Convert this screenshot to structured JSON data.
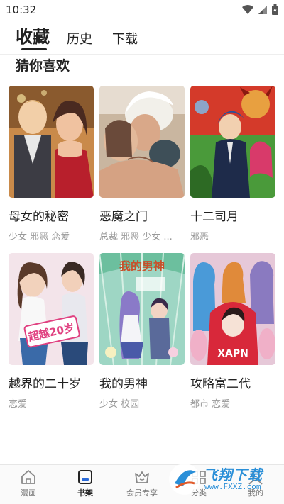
{
  "status": {
    "time": "10:32"
  },
  "tabs": {
    "active": "收藏",
    "history": "历史",
    "download": "下载"
  },
  "section": {
    "title": "猜你喜欢"
  },
  "comics": [
    {
      "title": "母女的秘密",
      "tags": "少女 邪恶 恋爱"
    },
    {
      "title": "恶魔之门",
      "tags": "总裁 邪恶 少女 ..."
    },
    {
      "title": "十二司月",
      "tags": "邪恶"
    },
    {
      "title": "越界的二十岁",
      "tags": "恋爱",
      "cover_text": "超越20岁"
    },
    {
      "title": "我的男神",
      "tags": "少女 校园",
      "cover_text": "我的男神"
    },
    {
      "title": "攻略富二代",
      "tags": "都市 恋爱",
      "cover_text": "XAPN"
    }
  ],
  "nav": [
    {
      "label": "漫画",
      "icon": "home-icon"
    },
    {
      "label": "书架",
      "icon": "bookshelf-icon",
      "active": true
    },
    {
      "label": "会员专享",
      "icon": "vip-crown-icon"
    },
    {
      "label": "分类",
      "icon": "category-icon"
    },
    {
      "label": "我的",
      "icon": "profile-icon"
    }
  ],
  "watermark": {
    "name": "飞翔下载",
    "url": "www.FXXZ.com"
  },
  "colors": {
    "accent": "#222222",
    "muted": "#999999",
    "watermark": "#2a8fd8"
  }
}
